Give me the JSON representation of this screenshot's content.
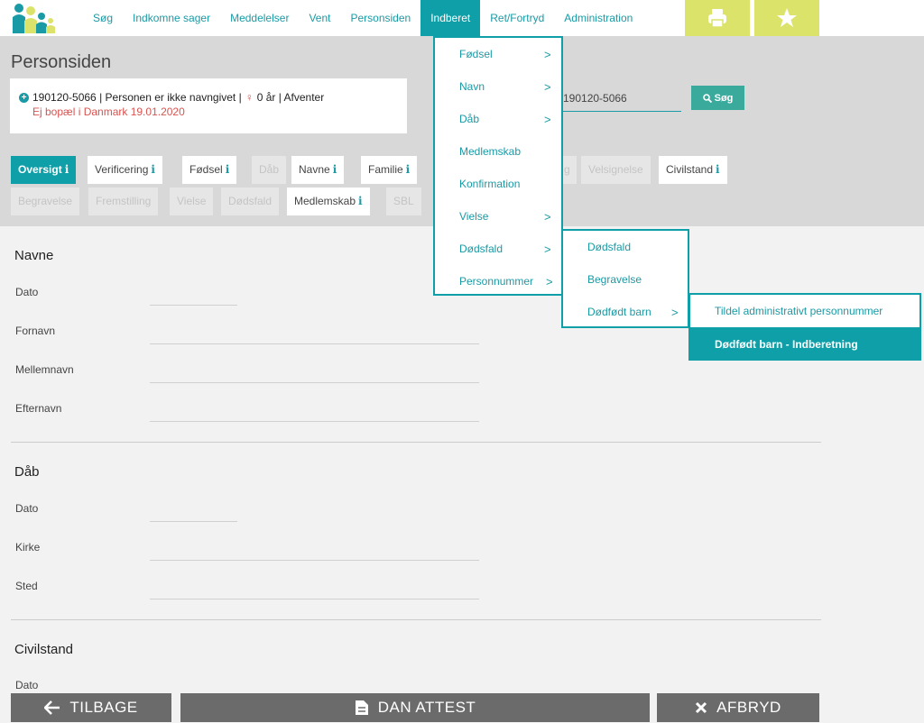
{
  "nav": {
    "items": [
      "Søg",
      "Indkomne sager",
      "Meddelelser",
      "Vent",
      "Personsiden",
      "Indberet",
      "Ret/Fortryd",
      "Administration"
    ],
    "active": "Indberet",
    "print_icon": "printer-icon",
    "star_icon": "star-icon"
  },
  "header": {
    "title": "Personsiden",
    "person_line": "190120-5066 | Personen er ikke navngivet | ",
    "person_age": "0 år | Afventer",
    "person_warning": "Ej bopæl i Danmark 19.01.2020",
    "search_value": "190120-5066",
    "search_button": "Søg"
  },
  "tabs": {
    "oversigt": "Oversigt",
    "verificering": "Verificering",
    "fodsel": "Fødsel",
    "dab": "Dåb",
    "navne": "Navne",
    "familie": "Familie",
    "hidden1": "g",
    "velsignelse": "Velsignelse",
    "civilstand": "Civilstand",
    "begravelse": "Begravelse",
    "fremstilling": "Fremstilling",
    "vielse": "Vielse",
    "dodsfald": "Dødsfald",
    "medlemskab": "Medlemskab",
    "sbl": "SBL"
  },
  "sections": {
    "navne": {
      "title": "Navne",
      "fields": [
        "Dato",
        "Fornavn",
        "Mellemnavn",
        "Efternavn"
      ]
    },
    "dab": {
      "title": "Dåb",
      "fields": [
        "Dato",
        "Kirke",
        "Sted"
      ]
    },
    "civilstand": {
      "title": "Civilstand",
      "fields": [
        "Dato"
      ]
    }
  },
  "menu1": [
    "Fødsel",
    "Navn",
    "Dåb",
    "Medlemskab",
    "Konfirmation",
    "Vielse",
    "Dødsfald",
    "Personnummer"
  ],
  "menu2": [
    "Dødsfald",
    "Begravelse",
    "Dødfødt barn"
  ],
  "menu3": [
    "Tildel administrativt personnummer",
    "Dødfødt barn - Indberetning"
  ],
  "bottom": {
    "back": "TILBAGE",
    "certificate": "DAN ATTEST",
    "cancel": "AFBRYD"
  },
  "colors": {
    "accent": "#0e9fa8",
    "yellow": "#dbe36a",
    "warning": "#d9534f",
    "bottom_button": "#6b6b6b"
  }
}
